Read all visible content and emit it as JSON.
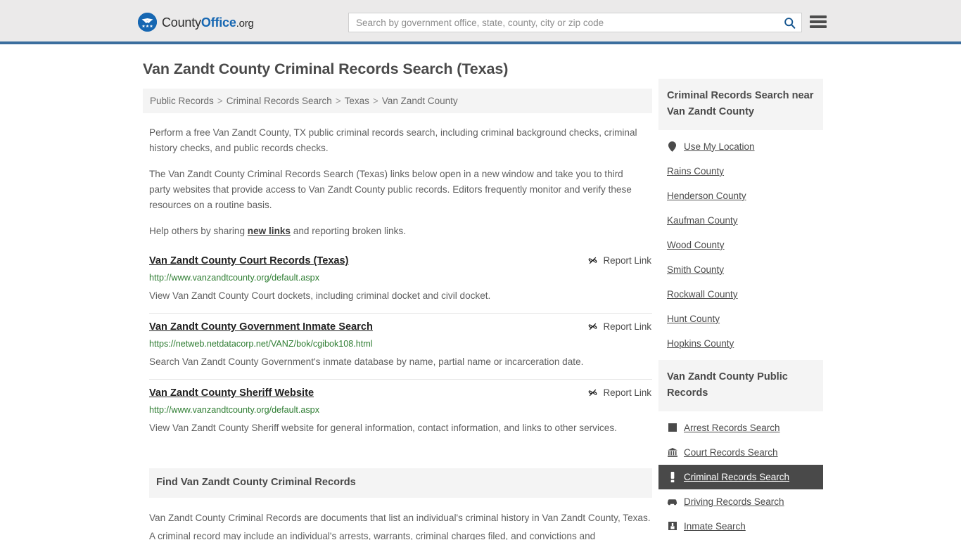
{
  "header": {
    "logo": {
      "part1": "County",
      "part2": "Office",
      "part3": ".org",
      "icon": "eagle-shield-logo"
    },
    "search": {
      "placeholder": "Search by government office, state, county, city or zip code",
      "value": "",
      "button_icon": "search-icon"
    },
    "menu_icon": "hamburger-menu-icon"
  },
  "page": {
    "title": "Van Zandt County Criminal Records Search (Texas)"
  },
  "breadcrumb": {
    "items": [
      "Public Records",
      "Criminal Records Search",
      "Texas",
      "Van Zandt County"
    ],
    "separator": ">"
  },
  "intro": {
    "p1": "Perform a free Van Zandt County, TX public criminal records search, including criminal background checks, criminal history checks, and public records checks.",
    "p2": "The Van Zandt County Criminal Records Search (Texas) links below open in a new window and take you to third party websites that provide access to Van Zandt County public records. Editors frequently monitor and verify these resources on a routine basis.",
    "p3_before": "Help others by sharing ",
    "p3_link": "new links",
    "p3_after": " and reporting broken links."
  },
  "results": {
    "report_label": "Report Link",
    "report_icon": "broken-link-icon",
    "items": [
      {
        "title": "Van Zandt County Court Records (Texas)",
        "url": "http://www.vanzandtcounty.org/default.aspx",
        "description": "View Van Zandt County Court dockets, including criminal docket and civil docket."
      },
      {
        "title": "Van Zandt County Government Inmate Search",
        "url": "https://netweb.netdatacorp.net/VANZ/bok/cgibok108.html",
        "description": "Search Van Zandt County Government's inmate database by name, partial name or incarceration date."
      },
      {
        "title": "Van Zandt County Sheriff Website",
        "url": "http://www.vanzandtcounty.org/default.aspx",
        "description": "View Van Zandt County Sheriff website for general information, contact information, and links to other services."
      }
    ]
  },
  "find_section": {
    "heading": "Find Van Zandt County Criminal Records",
    "body": "Van Zandt County Criminal Records are documents that list an individual's criminal history in Van Zandt County, Texas. A criminal record may include an individual's arrests, warrants, criminal charges filed, and convictions and"
  },
  "sidebar": {
    "nearby": {
      "heading": "Criminal Records Search near Van Zandt County",
      "use_my_location": {
        "label": "Use My Location",
        "icon": "map-pin-icon"
      },
      "counties": [
        "Rains County",
        "Henderson County",
        "Kaufman County",
        "Wood County",
        "Smith County",
        "Rockwall County",
        "Hunt County",
        "Hopkins County"
      ]
    },
    "public_records": {
      "heading": "Van Zandt County Public Records",
      "items": [
        {
          "label": "Arrest Records Search",
          "icon": "fingerprint-icon",
          "active": false
        },
        {
          "label": "Court Records Search",
          "icon": "courthouse-icon",
          "active": false
        },
        {
          "label": "Criminal Records Search",
          "icon": "exclamation-icon",
          "active": true
        },
        {
          "label": "Driving Records Search",
          "icon": "car-icon",
          "active": false
        },
        {
          "label": "Inmate Search",
          "icon": "jail-icon",
          "active": false
        }
      ]
    }
  },
  "colors": {
    "header_bg": "#ebeaea",
    "header_border": "#3b6e9e",
    "brand_blue": "#1667b2",
    "link_green": "#2e7d32",
    "panel_bg": "#f4f4f4",
    "active_bg": "#494949"
  }
}
